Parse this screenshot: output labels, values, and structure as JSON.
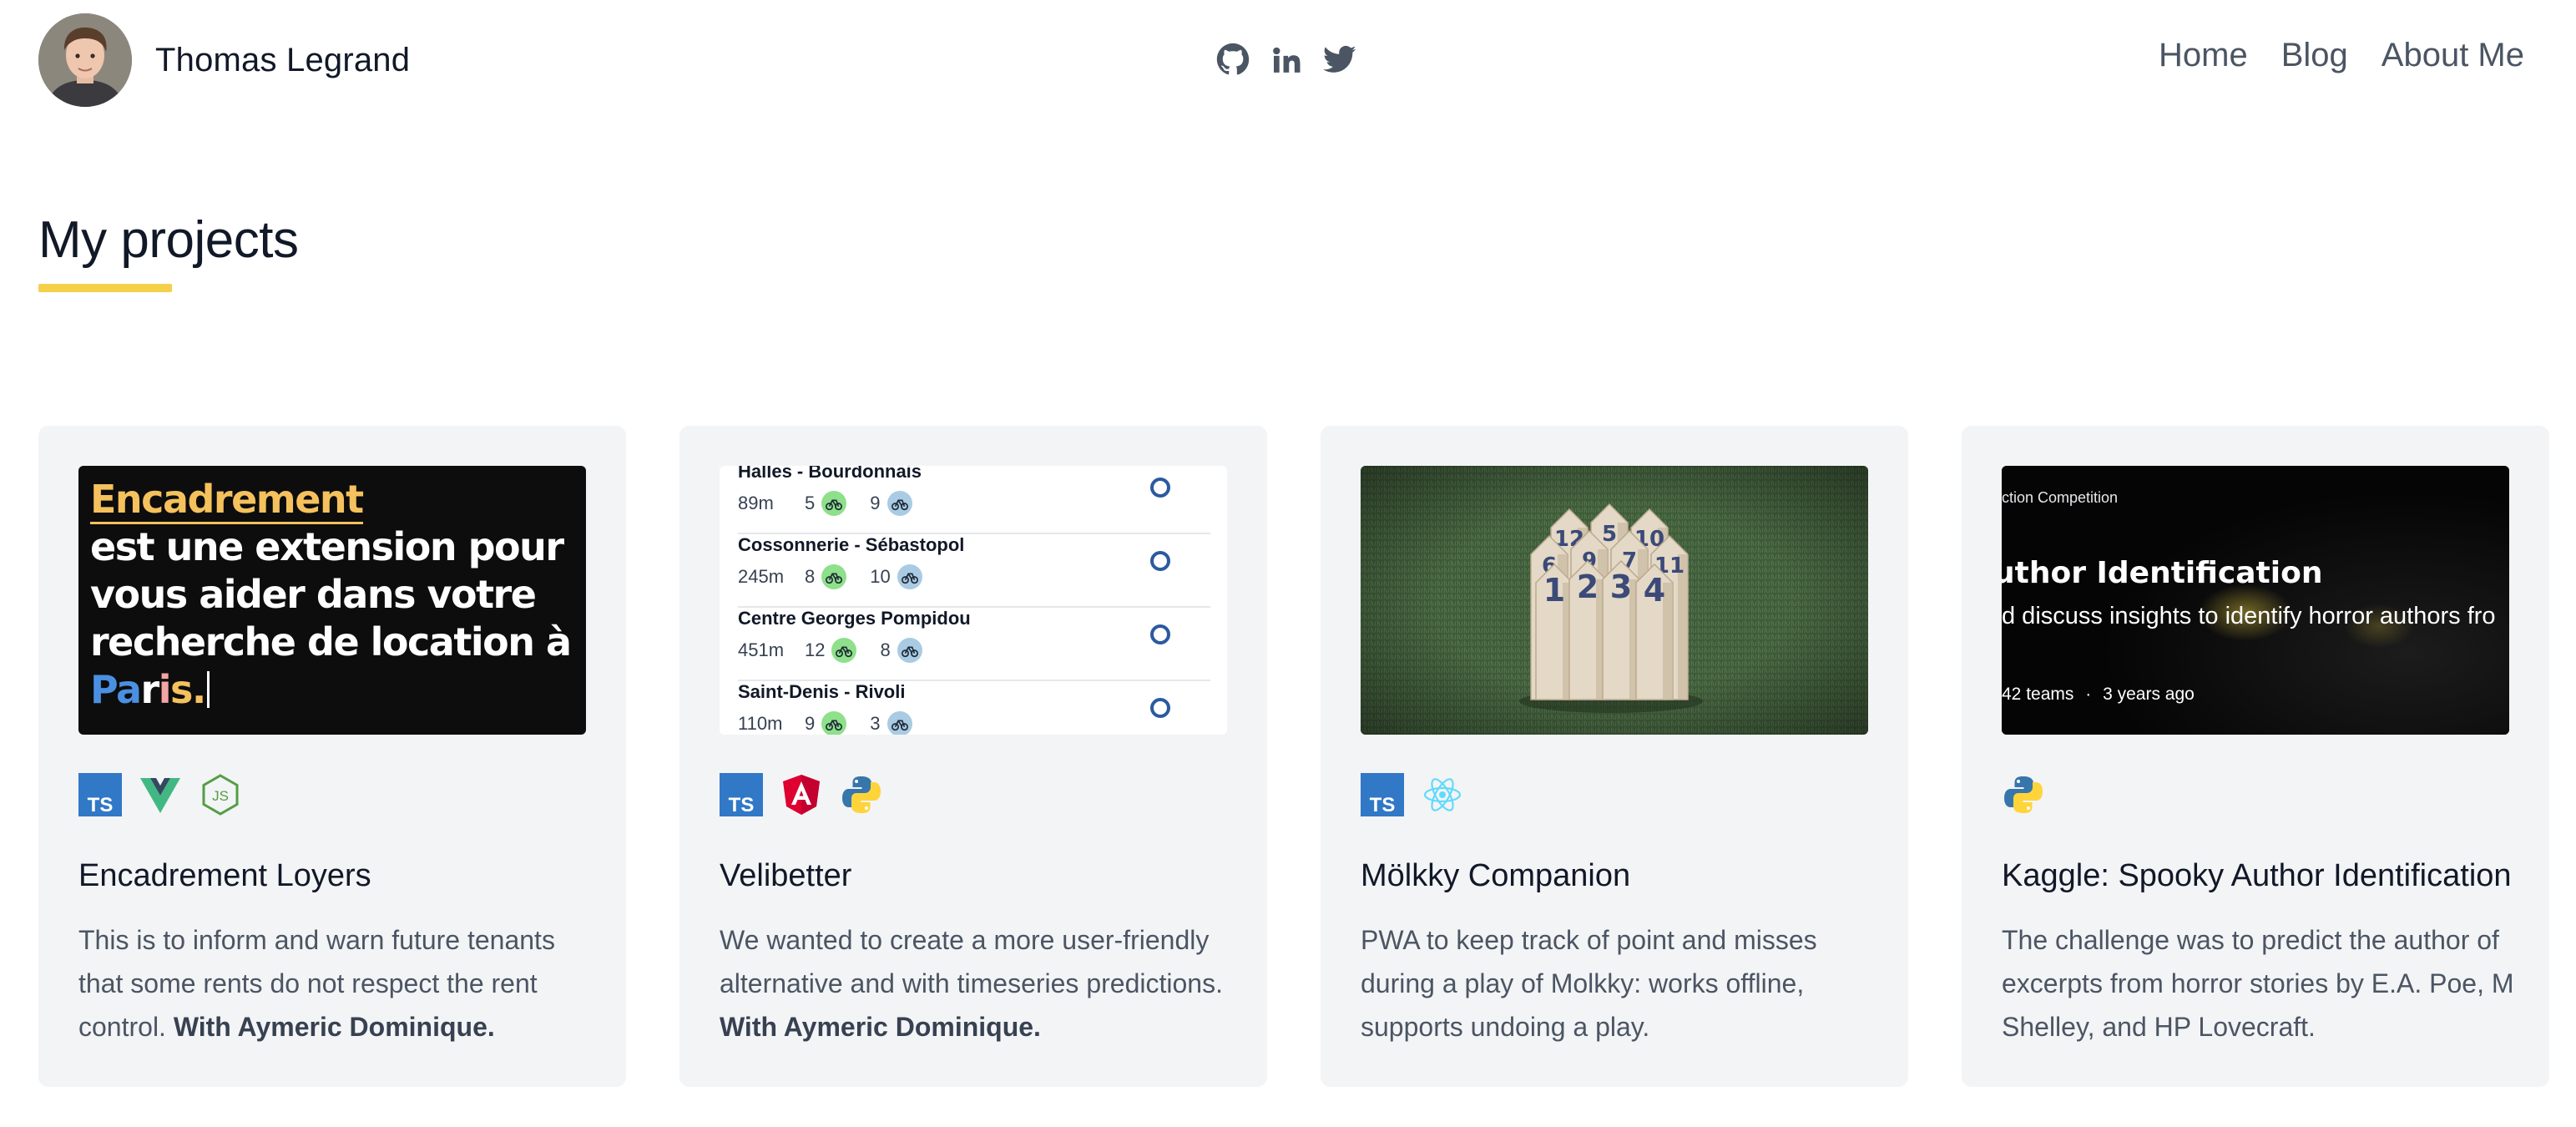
{
  "header": {
    "name": "Thomas Legrand",
    "social_icons": [
      "github-icon",
      "linkedin-icon",
      "twitter-icon"
    ],
    "nav": [
      "Home",
      "Blog",
      "About Me"
    ]
  },
  "section": {
    "title": "My projects",
    "accent_color": "#f5d04a"
  },
  "projects": [
    {
      "thumb": {
        "highlight": "Encadrement",
        "text": "est une extension pour vous aider dans votre recherche de location à",
        "city_letters": [
          "Pa",
          "r",
          "i",
          "s."
        ]
      },
      "tech": [
        "typescript-icon",
        "vue-icon",
        "nodejs-icon"
      ],
      "title": "Encadrement Loyers",
      "desc": "This is to inform and warn future tenants that some rents do not respect the rent control.",
      "credit": "With Aymeric Dominique."
    },
    {
      "thumb": {
        "stations": [
          {
            "name": "Halles - Bourdonnais",
            "dist": "89m",
            "a": "5",
            "b": "9"
          },
          {
            "name": "Cossonnerie - Sébastopol",
            "dist": "245m",
            "a": "8",
            "b": "10"
          },
          {
            "name": "Centre Georges Pompidou",
            "dist": "451m",
            "a": "12",
            "b": "8"
          },
          {
            "name": "Saint-Denis - Rivoli",
            "dist": "110m",
            "a": "9",
            "b": "3"
          }
        ]
      },
      "tech": [
        "typescript-icon",
        "angular-icon",
        "python-icon"
      ],
      "title": "Velibetter",
      "desc": "We wanted to create a more user-friendly alternative and with timeseries predictions.",
      "credit": "With Aymeric Dominique."
    },
    {
      "thumb": {
        "pins": [
          "12",
          "5",
          "10",
          "6",
          "9",
          "7",
          "11",
          "1",
          "2",
          "3",
          "4"
        ]
      },
      "tech": [
        "typescript-icon",
        "react-icon"
      ],
      "title": "Mölkky Companion",
      "desc": "PWA to keep track of point and misses during a play of Molkky: works offline, supports undoing a play.",
      "credit": ""
    },
    {
      "thumb": {
        "competition": "ction Competition",
        "title": "uthor Identification",
        "subtitle": "d discuss insights to identify horror authors fro",
        "teams": "42 teams",
        "age": "3 years ago"
      },
      "tech": [
        "python-icon"
      ],
      "title": "Kaggle: Spooky Author Identification",
      "desc": "The challenge was to predict the author of excerpts from horror stories by E.A. Poe, M Shelley, and HP Lovecraft.",
      "credit": ""
    }
  ]
}
